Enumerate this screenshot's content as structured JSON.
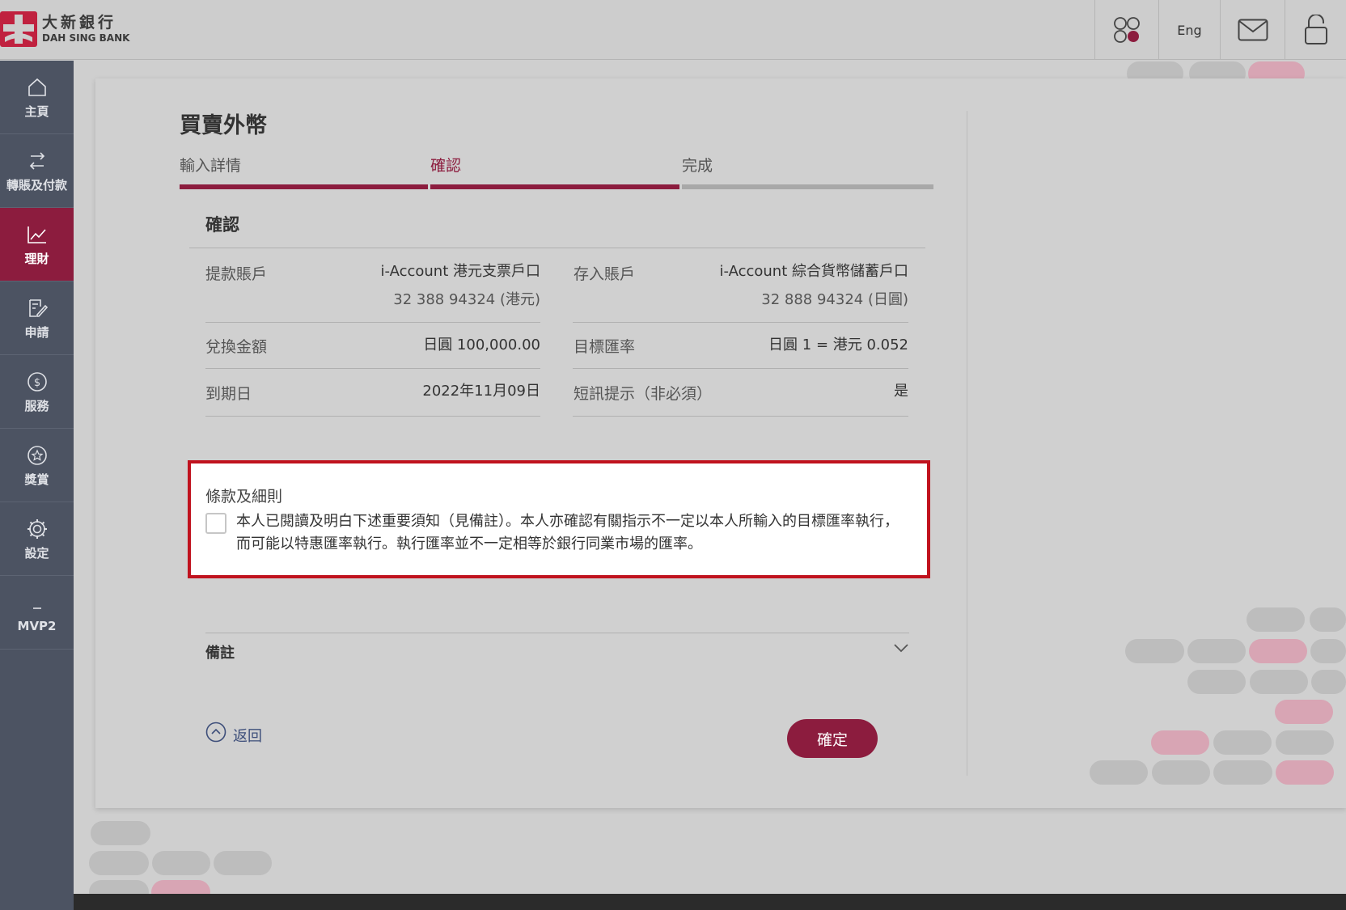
{
  "brand": {
    "name_cn": "大新銀行",
    "name_en": "DAH SING BANK",
    "logo_color": "#c0213f"
  },
  "header": {
    "lang_label": "Eng"
  },
  "sidebar": {
    "items": [
      {
        "label": "主頁",
        "icon": "home-icon"
      },
      {
        "label": "轉賬及付款",
        "icon": "transfer-icon"
      },
      {
        "label": "理財",
        "icon": "chart-icon",
        "active": true
      },
      {
        "label": "申請",
        "icon": "edit-icon"
      },
      {
        "label": "服務",
        "icon": "dollar-icon"
      },
      {
        "label": "獎賞",
        "icon": "star-icon"
      },
      {
        "label": "設定",
        "icon": "gear-icon"
      },
      {
        "label": "MVP2",
        "icon": "dash-icon"
      }
    ]
  },
  "page": {
    "title": "買賣外幣",
    "steps": [
      "輸入詳情",
      "確認",
      "完成"
    ],
    "current_step": 2,
    "section_title": "確認",
    "debit_account": {
      "label": "提款賬戶",
      "name": "i-Account 港元支票戶口",
      "number": "32 388 94324 (港元)"
    },
    "credit_account": {
      "label": "存入賬戶",
      "name": "i-Account 綜合貨幣儲蓄戶口",
      "number": "32 888 94324 (日圓)"
    },
    "amount": {
      "label": "兌換金額",
      "value": "日圓 100,000.00"
    },
    "target_rate": {
      "label": "目標匯率",
      "value": "日圓 1 = 港元 0.052"
    },
    "expiry": {
      "label": "到期日",
      "value": "2022年11月09日"
    },
    "sms": {
      "label": "短訊提示（非必須）",
      "value": "是"
    },
    "terms": {
      "title": "條款及細則",
      "text": "本人已閱讀及明白下述重要須知（見備註）。本人亦確認有關指示不一定以本人所輸入的目標匯率執行，而可能以特惠匯率執行。執行匯率並不一定相等於銀行同業市場的匯率。",
      "checked": false
    },
    "remarks_label": "備註",
    "back_label": "返回",
    "confirm_label": "確定"
  },
  "colors": {
    "accent": "#8c1c3e",
    "sidebar_bg": "#4c5362",
    "highlight_border": "#c0121e"
  }
}
